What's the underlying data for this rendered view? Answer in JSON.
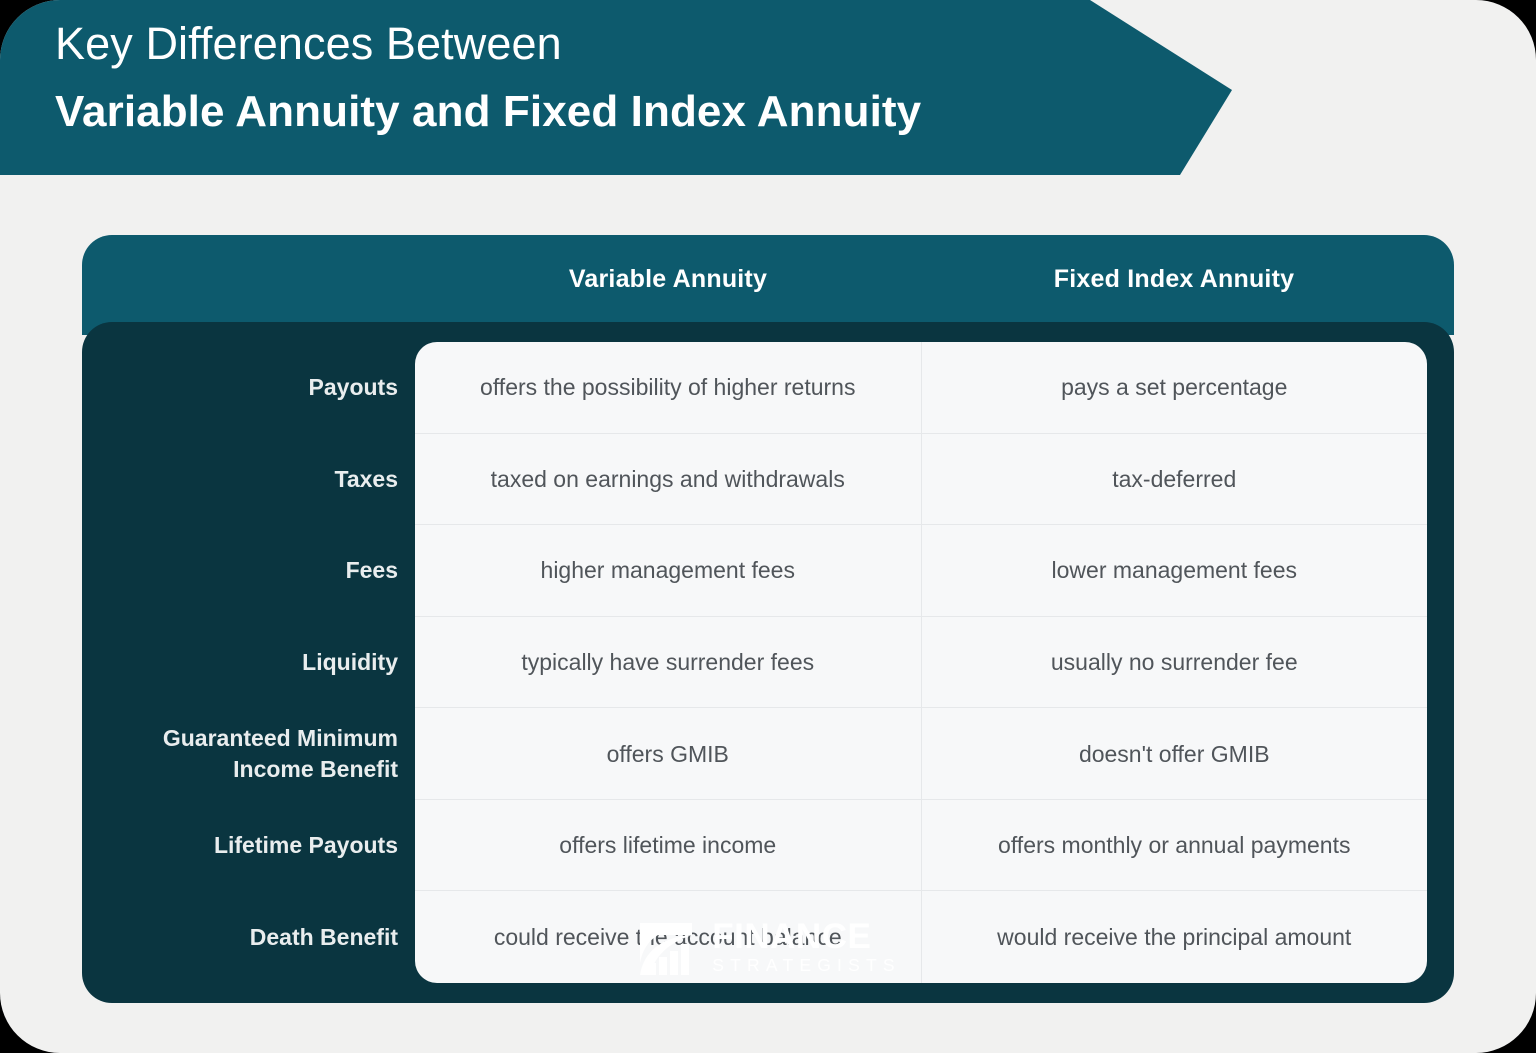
{
  "banner": {
    "title_line1": "Key Differences Between",
    "title_line2": "Variable Annuity and Fixed Index Annuity",
    "background_color": "#0d5a6d",
    "text_color": "#ffffff"
  },
  "table": {
    "header": {
      "col1": "Variable Annuity",
      "col2": "Fixed Index Annuity",
      "background_color": "#0d5a6d"
    },
    "body_background_color": "#0a3540",
    "panel_background_color": "#f7f8f9",
    "rows": [
      {
        "label": "Payouts",
        "variable_annuity": "offers the possibility of higher returns",
        "fixed_index_annuity": "pays a set percentage"
      },
      {
        "label": "Taxes",
        "variable_annuity": "taxed on earnings and withdrawals",
        "fixed_index_annuity": "tax-deferred"
      },
      {
        "label": "Fees",
        "variable_annuity": "higher management fees",
        "fixed_index_annuity": "lower management fees"
      },
      {
        "label": "Liquidity",
        "variable_annuity": "typically have surrender fees",
        "fixed_index_annuity": "usually no surrender fee"
      },
      {
        "label": "Guaranteed Minimum Income Benefit",
        "variable_annuity": "offers GMIB",
        "fixed_index_annuity": "doesn't offer GMIB"
      },
      {
        "label": "Lifetime Payouts",
        "variable_annuity": "offers lifetime income",
        "fixed_index_annuity": "offers monthly or annual payments"
      },
      {
        "label": "Death Benefit",
        "variable_annuity": "could receive the account balance",
        "fixed_index_annuity": "would receive the principal amount"
      }
    ]
  },
  "logo": {
    "word_primary": "FINANCE",
    "word_secondary": "STRATEGISTS",
    "mark": "rising-bar-chart-swoosh-icon",
    "color": "#ffffff"
  },
  "canvas": {
    "background_color": "#f1f1f0",
    "outer_color": "#000000"
  }
}
